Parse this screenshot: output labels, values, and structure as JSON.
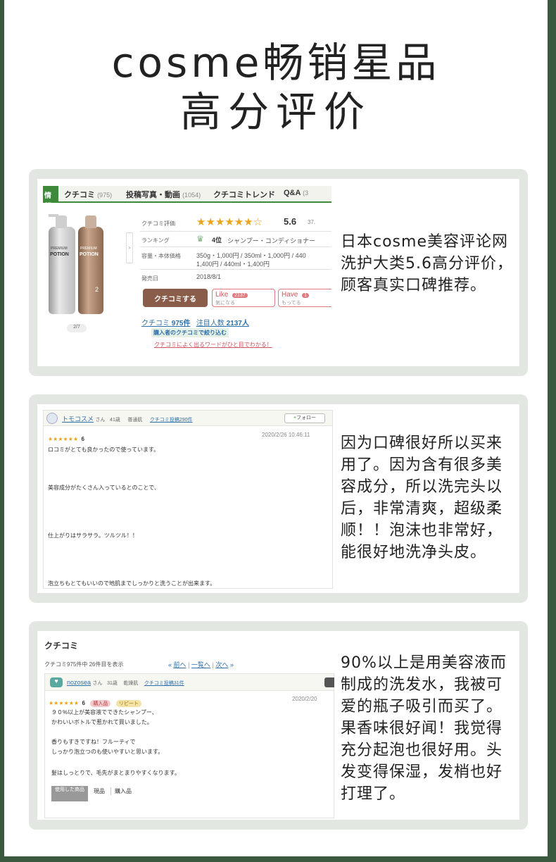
{
  "headline": {
    "line1": "cosme畅销星品",
    "line2": "高分评价"
  },
  "card1": {
    "tabs": {
      "active": "情報",
      "t1": "クチコミ",
      "t1_count": "(975)",
      "t2": "投稿写真・動画",
      "t2_count": "(1054)",
      "t3": "クチコミトレンド",
      "t4": "Q&A",
      "t4_count": "(3"
    },
    "bottle": {
      "brand": "PREMIUM",
      "name": "POTION",
      "number": "2"
    },
    "pager": "2/7",
    "rows": {
      "rating_label": "クチコミ評価",
      "rating_value": "5.6",
      "rating_extra": "37.",
      "ranking_label": "ランキング",
      "ranking_value": "4位",
      "ranking_category": "シャンプー・コンディショナー",
      "price_label": "容量・本体価格",
      "price_line1": "350g・1,000円 / 350ml・1,000円 / 440",
      "price_line2": "1,400円 / 440ml・1,400円",
      "release_label": "発売日",
      "release_value": "2018/8/1"
    },
    "buttons": {
      "kuchikomi": "クチコミする",
      "like": "Like",
      "like_sub": "気になる",
      "like_count": "2137",
      "have": "Have",
      "have_sub": "もってる",
      "have_count": "1"
    },
    "stats": {
      "reviews_label": "クチコミ",
      "reviews_count": "975件",
      "attention_label": "注目人数",
      "attention_count": "2137人"
    },
    "links": {
      "filter": "購入者のクチコミで絞り込む",
      "words": "クチコミによく出るワードがひと目でわかる！"
    },
    "description": "日本cosme美容评论网洗护大类5.6高分评价，顾客真实口碑推荐。"
  },
  "card2": {
    "user": {
      "name": "トモコスメ",
      "suffix": "さん",
      "age": "41歳",
      "skin": "普通肌",
      "posts": "クチコミ投稿290件",
      "follow": "フォロー"
    },
    "rating": "6",
    "date": "2020/2/26 10:46:11",
    "lines": [
      "ロコミがとても良かったので使っています。",
      "美容成分がたくさん入っているとのことで、",
      "仕上がりはサラサラ。ツルツル！！",
      "泡立ちもとてもいいので地肌までしっかりと洗うことが出来ます。"
    ],
    "description": "因为口碑很好所以买来用了。因为含有很多美容成分，所以洗完头以后，非常清爽，超级柔顺！！泡沫也非常好，能很好地洗净头皮。"
  },
  "card3": {
    "title": "クチコミ",
    "count_text": "クチコミ975件中 26件目を表示",
    "nav": {
      "prev": "前へ",
      "list": "一覧へ",
      "next": "次へ"
    },
    "user": {
      "name": "nozosea",
      "suffix": "さん",
      "age": "31歳",
      "skin": "乾燥肌",
      "posts": "クチコミ投稿31件"
    },
    "rating": "6",
    "tags": {
      "purchase": "購入品",
      "repeat": "リピート"
    },
    "date": "2020/2/20",
    "lines": [
      "９０%以上が美容液でできたシャンプー、",
      "かわいいボトルで惹かれて買いました。",
      "香りもすきですね！フルーティで",
      "しっかり泡立つのも使いやすいと思います。",
      "髪はしっとりで、毛先がまとまりやすくなります。"
    ],
    "footer": {
      "used": "使用した商品",
      "current": "現品",
      "purchase": "購入品"
    },
    "description": "90%以上是用美容液而制成的洗发水，我被可爱的瓶子吸引而买了。果香味很好闻！我觉得充分起泡也很好用。头发变得保湿，发梢也好打理了。"
  },
  "colors": {
    "accent_green": "#3d8a3a",
    "star": "#e9a51b",
    "card_bg": "#e3e7e1",
    "frame": "#3a5a40"
  }
}
